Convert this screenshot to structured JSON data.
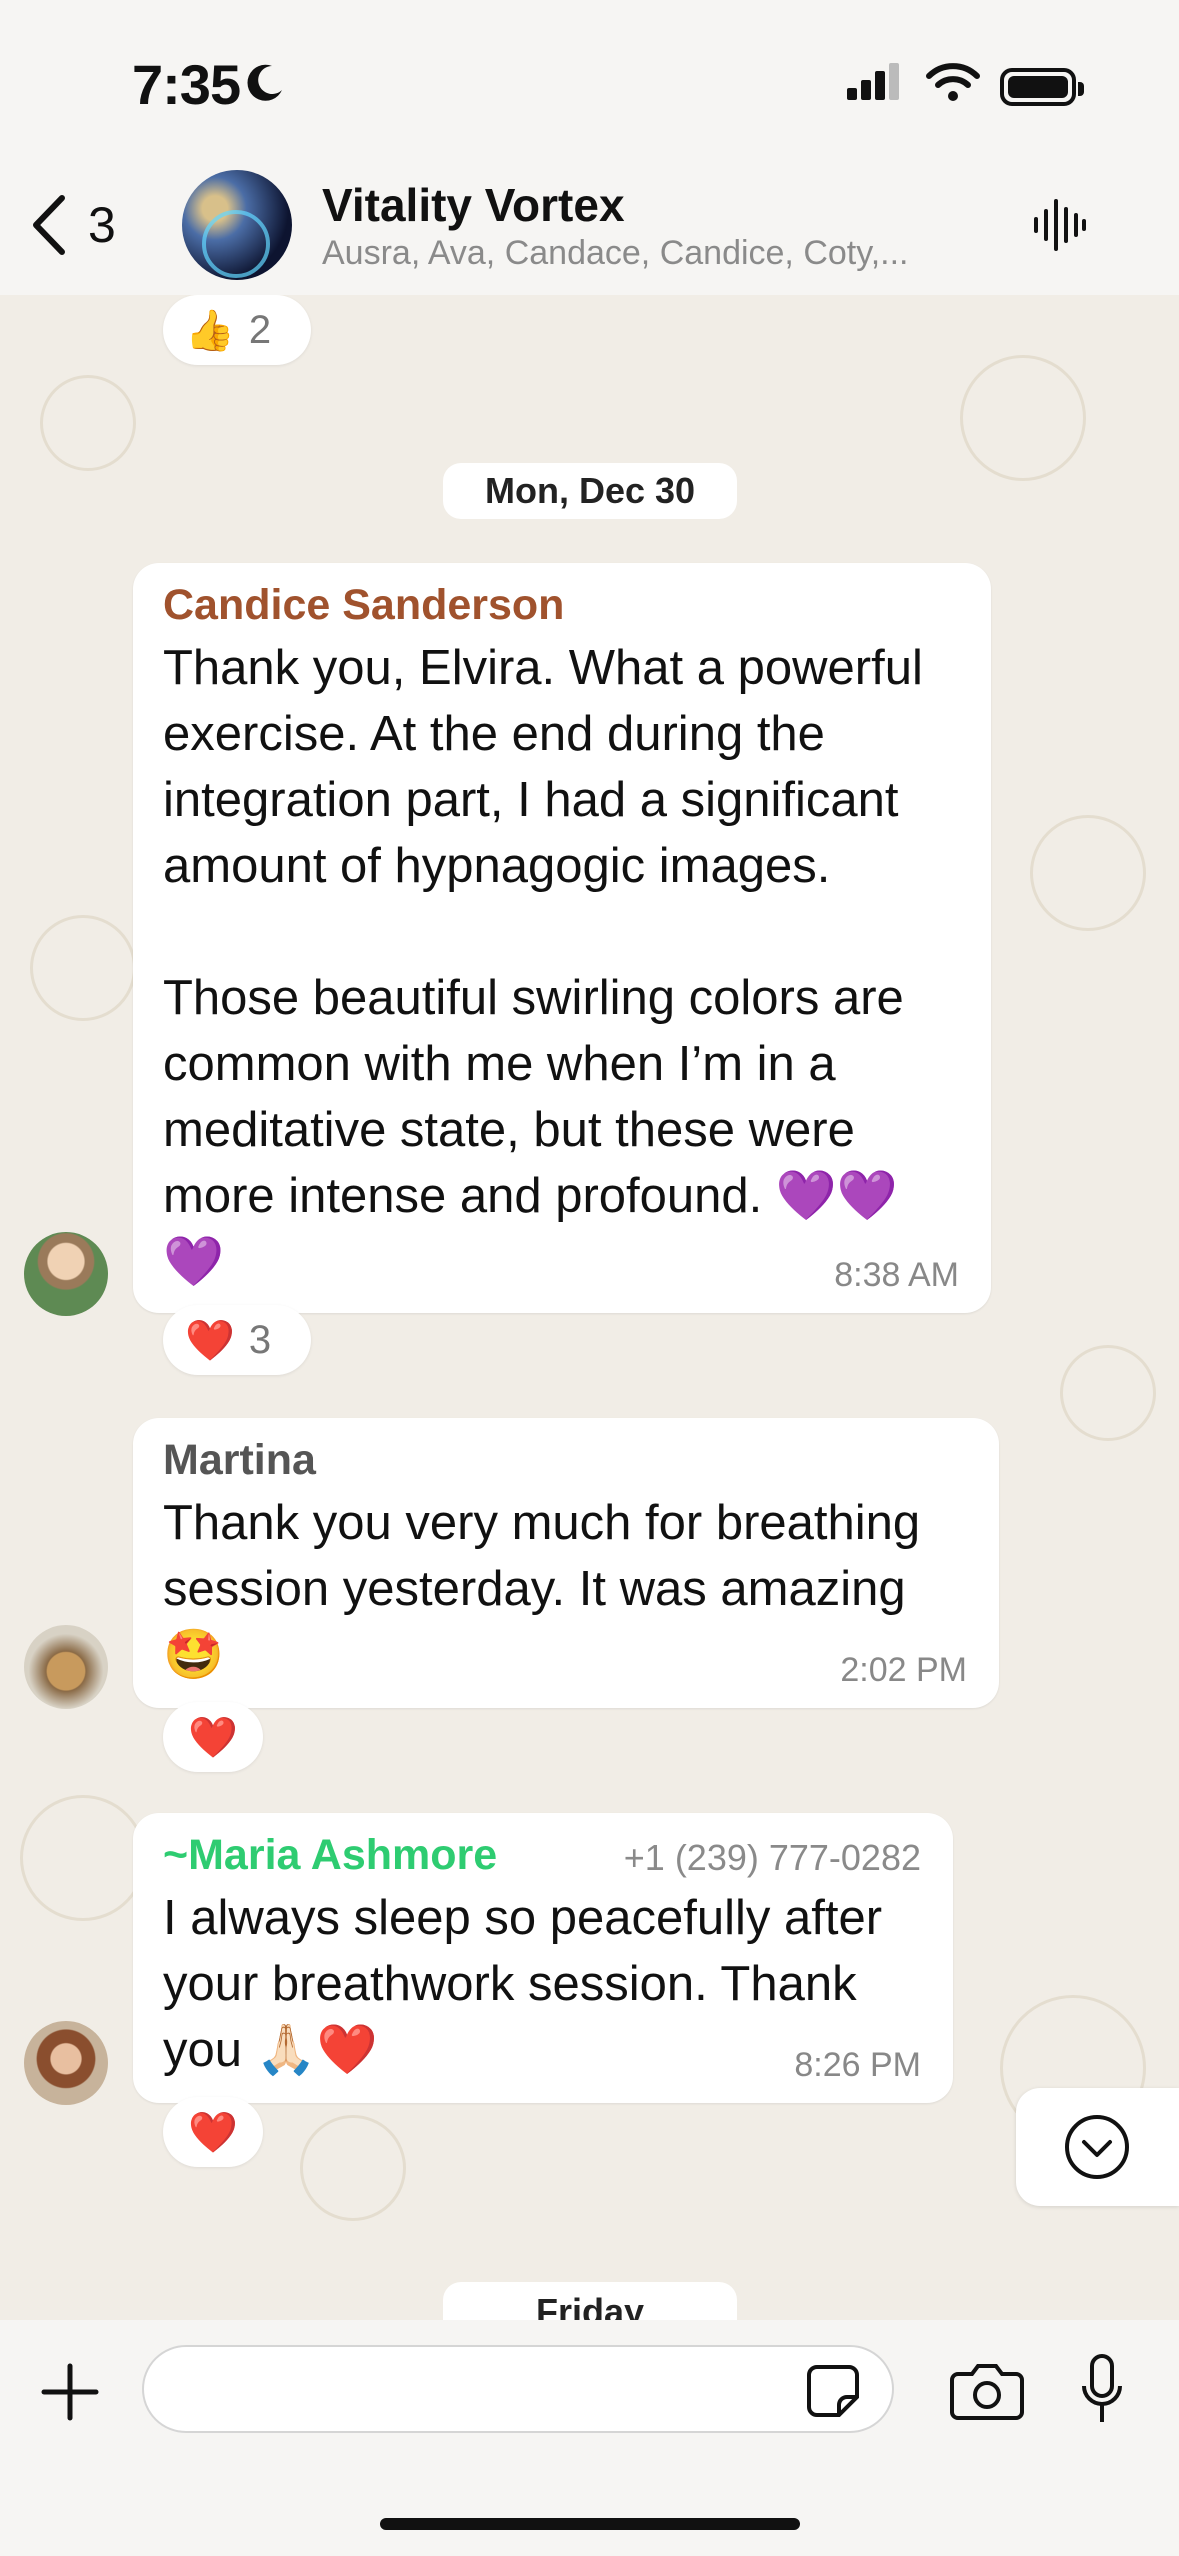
{
  "status": {
    "time": "7:35"
  },
  "header": {
    "back_count": "3",
    "title": "Vitality Vortex",
    "subtitle": "Ausra, Ava, Candace, Candice, Coty,..."
  },
  "messages": {
    "top_reaction": {
      "emoji": "👍",
      "count": "2"
    },
    "date_chip": "Mon, Dec 30",
    "m1": {
      "sender": "Candice Sanderson",
      "text": "Thank you, Elvira. What a powerful\nexercise. At the end during the\nintegration part, I had a significant\namount of hypnagogic images.\n\nThose beautiful swirling colors are\ncommon with me when I’m in a\nmeditative state, but these were\nmore intense and profound. 💜💜\n💜",
      "time": "8:38 AM",
      "reaction_emoji": "❤️",
      "reaction_count": "3"
    },
    "m2": {
      "sender": "Martina",
      "text": "Thank you very much for breathing\nsession yesterday. It was amazing\n🤩",
      "time": "2:02 PM",
      "reaction_emoji": "❤️"
    },
    "m3": {
      "sender": "~Maria Ashmore",
      "phone": "+1 (239) 777-0282",
      "text": "I always sleep so peacefully after\nyour breathwork session. Thank\nyou 🙏🏻❤️",
      "time": "8:26 PM",
      "reaction_emoji": "❤️"
    },
    "next_date_chip": "Friday"
  },
  "colors": {
    "m1_sender": "#a0522d",
    "m2_sender": "#555555",
    "m3_sender": "#2ecc71"
  }
}
